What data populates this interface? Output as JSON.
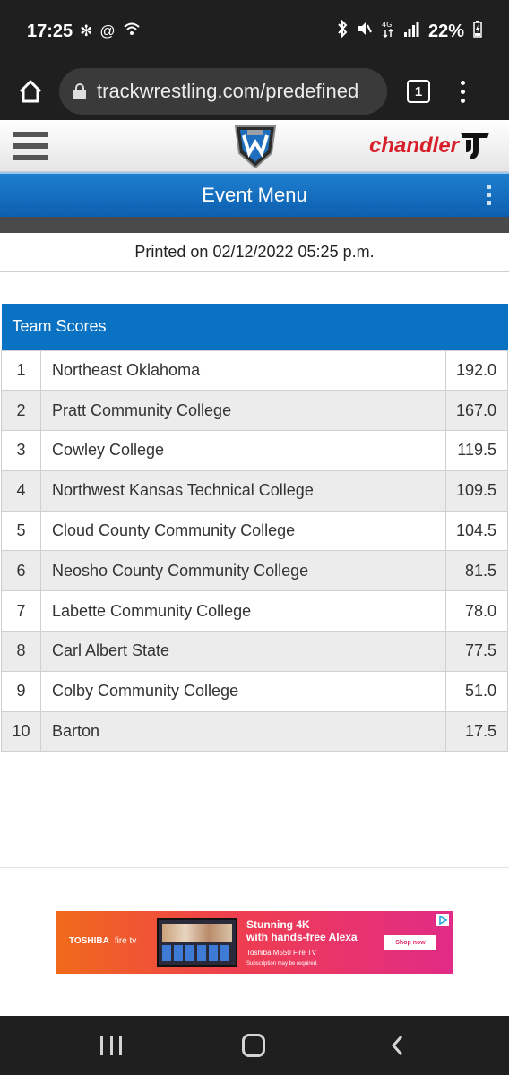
{
  "status_bar": {
    "time": "17:25",
    "left_icons": [
      "fan-icon",
      "at-icon",
      "wifi-question-icon"
    ],
    "right_icons": [
      "bluetooth-icon",
      "mute-icon",
      "4g-icon",
      "signal-icon"
    ],
    "battery": "22%"
  },
  "browser": {
    "url": "trackwrestling.com/predefined",
    "tab_count": "1"
  },
  "site": {
    "sponsor": "chandler",
    "event_menu": "Event Menu",
    "printed": "Printed on 02/12/2022 05:25 p.m."
  },
  "team_scores": {
    "header": "Team Scores",
    "rows": [
      {
        "rank": "1",
        "team": "Northeast Oklahoma",
        "score": "192.0"
      },
      {
        "rank": "2",
        "team": "Pratt Community College",
        "score": "167.0"
      },
      {
        "rank": "3",
        "team": "Cowley College",
        "score": "119.5"
      },
      {
        "rank": "4",
        "team": "Northwest Kansas Technical College",
        "score": "109.5"
      },
      {
        "rank": "5",
        "team": "Cloud County Community College",
        "score": "104.5"
      },
      {
        "rank": "6",
        "team": "Neosho County Community College",
        "score": "81.5"
      },
      {
        "rank": "7",
        "team": "Labette Community College",
        "score": "78.0"
      },
      {
        "rank": "8",
        "team": "Carl Albert State",
        "score": "77.5"
      },
      {
        "rank": "9",
        "team": "Colby Community College",
        "score": "51.0"
      },
      {
        "rank": "10",
        "team": "Barton",
        "score": "17.5"
      }
    ]
  },
  "ad": {
    "brand": "TOSHIBA",
    "partner": "fire tv",
    "headline_1": "Stunning 4K",
    "headline_2": "with hands-free Alexa",
    "subline": "Toshiba M550 Fire TV",
    "fine_print": "Subscription may be required.",
    "cta": "Shop now"
  },
  "colors": {
    "header_blue": "#0a72c2",
    "accent_red": "#d8202a"
  }
}
